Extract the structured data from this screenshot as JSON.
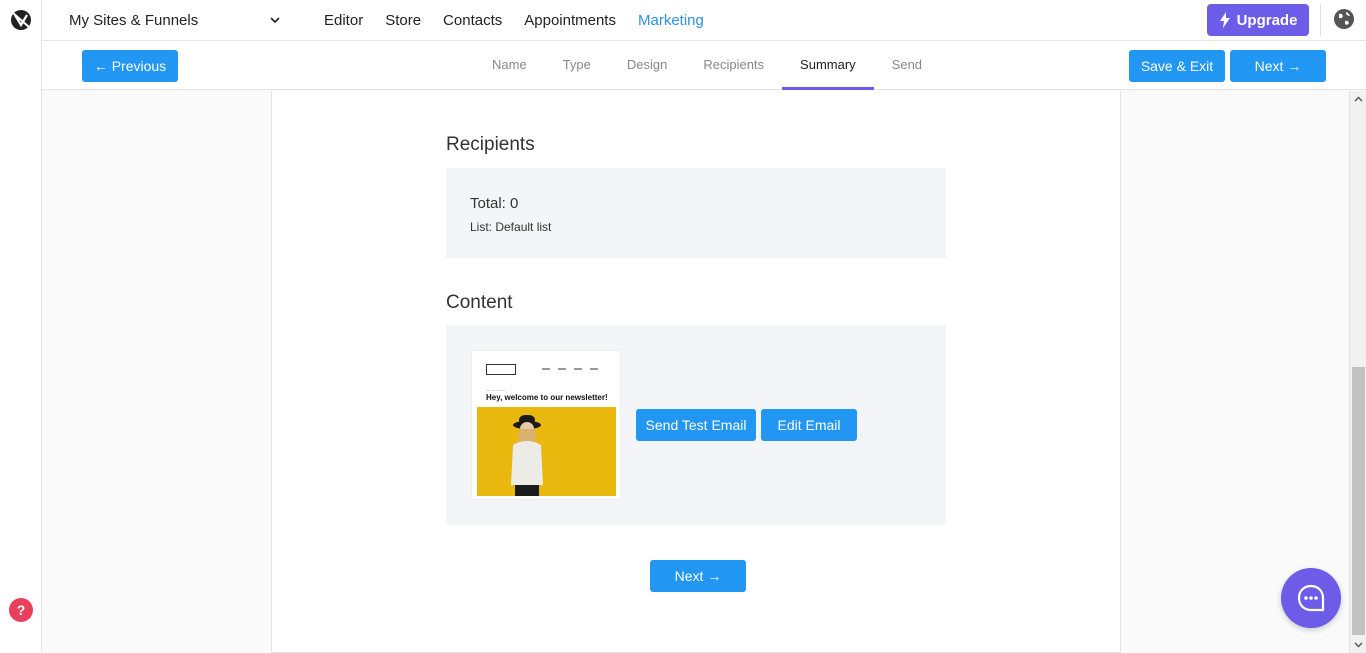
{
  "app": {
    "logo_icon": "brand-logo-icon",
    "help_label": "?"
  },
  "topnav": {
    "site_selector": "My Sites & Funnels",
    "links": [
      "Editor",
      "Store",
      "Contacts",
      "Appointments",
      "Marketing"
    ],
    "active_link": "Marketing",
    "upgrade_label": "Upgrade"
  },
  "stepbar": {
    "previous_label": "← Previous",
    "save_exit_label": "Save & Exit",
    "next_label": "Next →",
    "tabs": [
      "Name",
      "Type",
      "Design",
      "Recipients",
      "Summary",
      "Send"
    ],
    "active_tab": "Summary"
  },
  "recipients": {
    "title": "Recipients",
    "total": "Total: 0",
    "list": "List: Default list"
  },
  "content": {
    "title": "Content",
    "thumbnail_heading": "Hey, welcome to our newsletter!",
    "send_test_label": "Send Test Email",
    "edit_email_label": "Edit Email"
  },
  "footer": {
    "next_label": "Next →"
  },
  "colors": {
    "primary": "#2196f3",
    "accent": "#6c5ce7",
    "help": "#e8405c",
    "active_link": "#2f8fe8"
  }
}
